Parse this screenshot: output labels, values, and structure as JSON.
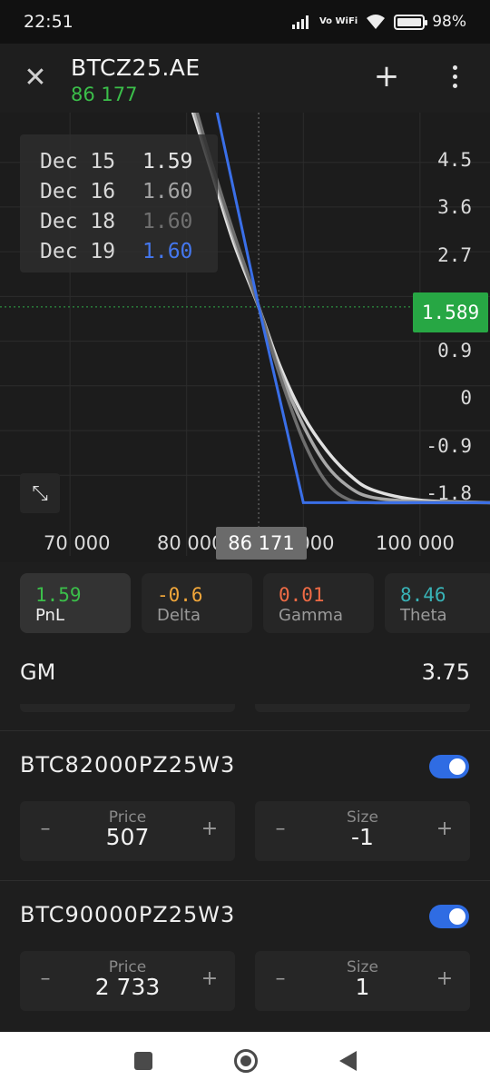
{
  "status": {
    "time": "22:51",
    "network": "Vo WiFi",
    "battery": "98%"
  },
  "header": {
    "title": "BTCZ25.AE",
    "price": "86 177"
  },
  "chart_data": {
    "type": "line",
    "x_ticks": [
      "70 000",
      "80 000",
      "90 000",
      "100 000"
    ],
    "y_ticks": [
      "4.5",
      "3.6",
      "2.7",
      "0.9",
      "0",
      "-0.9",
      "-1.8"
    ],
    "xlim": [
      64000,
      106000
    ],
    "ylim": [
      -2.6,
      5.5
    ],
    "cursor": {
      "x_label": "86 171",
      "y_label": "1.589",
      "x": 86171,
      "y": 1.589
    },
    "tooltip": [
      {
        "date": "Dec 15",
        "value": "1.59",
        "color": "#e4e4e4"
      },
      {
        "date": "Dec 16",
        "value": "1.60",
        "color": "#a4a4a4"
      },
      {
        "date": "Dec 18",
        "value": "1.60",
        "color": "#707070"
      },
      {
        "date": "Dec 19",
        "value": "1.60",
        "color": "#4477ee"
      }
    ],
    "series": [
      {
        "name": "Dec 15",
        "color": "#e0e0e0",
        "x": [
          66000,
          78000,
          80000,
          82000,
          84000,
          86171,
          88000,
          90000,
          92000,
          94000,
          96000,
          100000,
          106000
        ],
        "y": [
          12,
          7.3,
          5.9,
          4.4,
          2.9,
          1.59,
          0.4,
          -0.6,
          -1.3,
          -1.8,
          -2.1,
          -2.3,
          -2.35
        ]
      },
      {
        "name": "Dec 16",
        "color": "#a8a8a8",
        "x": [
          66000,
          78000,
          80000,
          82000,
          84000,
          86171,
          88000,
          90000,
          92000,
          94000,
          96000,
          100000,
          106000
        ],
        "y": [
          12,
          7.3,
          6.0,
          4.5,
          3.0,
          1.6,
          0.3,
          -0.8,
          -1.6,
          -2.05,
          -2.25,
          -2.33,
          -2.35
        ]
      },
      {
        "name": "Dec 18",
        "color": "#6e6e6e",
        "x": [
          66000,
          78000,
          80000,
          82000,
          84000,
          86171,
          88000,
          90000,
          92000,
          94000,
          96000,
          100000,
          106000
        ],
        "y": [
          12,
          7.5,
          6.2,
          4.6,
          3.1,
          1.6,
          0.2,
          -1.1,
          -1.95,
          -2.3,
          -2.35,
          -2.35,
          -2.35
        ]
      },
      {
        "name": "Dec 19",
        "color": "#3a6fe8",
        "x": [
          66000,
          82000,
          86171,
          90000,
          106000
        ],
        "y": [
          14,
          6.17,
          1.6,
          -2.35,
          -2.35
        ]
      }
    ]
  },
  "greeks": [
    {
      "value": "1.59",
      "label": "PnL",
      "color": "#3bbf4a",
      "active": true
    },
    {
      "value": "-0.6",
      "label": "Delta",
      "color": "#f0a63a",
      "active": false
    },
    {
      "value": "0.01",
      "label": "Gamma",
      "color": "#ef6b45",
      "active": false
    },
    {
      "value": "8.46",
      "label": "Theta",
      "color": "#38b2b6",
      "active": false
    }
  ],
  "gm": {
    "label": "GM",
    "value": "3.75"
  },
  "legs": [
    {
      "name": "BTC82000PZ25W3",
      "enabled": true,
      "price_label": "Price",
      "price": "507",
      "size_label": "Size",
      "size": "-1"
    },
    {
      "name": "BTC90000PZ25W3",
      "enabled": true,
      "price_label": "Price",
      "price": "2 733",
      "size_label": "Size",
      "size": "1"
    }
  ],
  "stepper_symbols": {
    "minus": "–",
    "plus": "+"
  }
}
